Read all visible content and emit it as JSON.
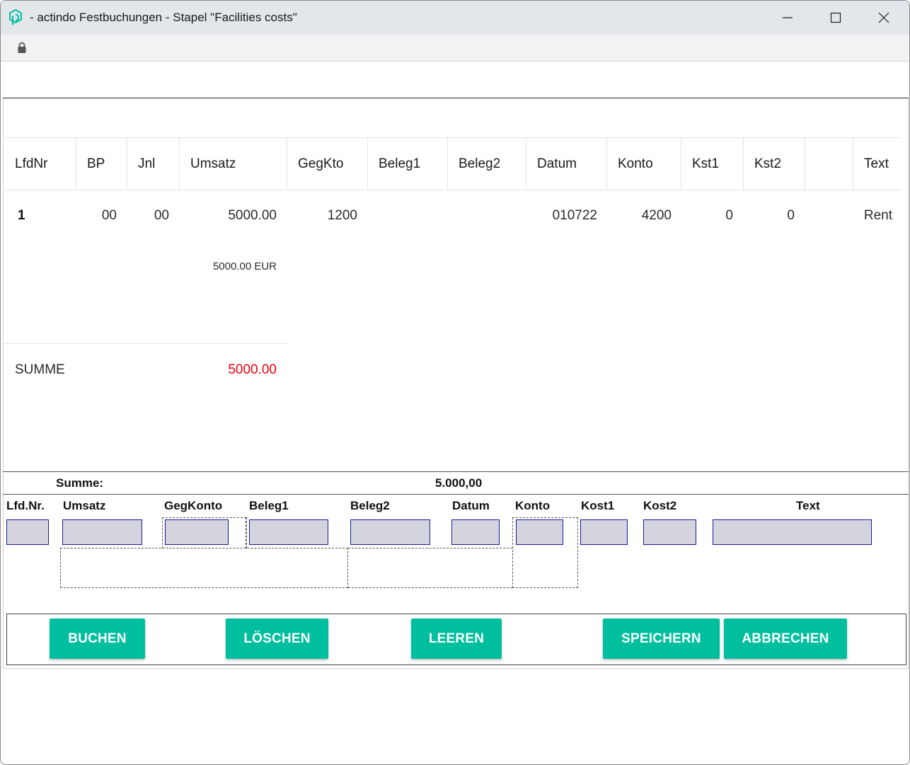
{
  "window": {
    "title": "- actindo Festbuchungen - Stapel \"Facilities costs\"",
    "brand_color": "#00bf9f"
  },
  "grid": {
    "columns": [
      "LfdNr",
      "BP",
      "Jnl",
      "Umsatz",
      "GegKto",
      "Beleg1",
      "Beleg2",
      "Datum",
      "Konto",
      "Kst1",
      "Kst2",
      "",
      "Text"
    ],
    "rows": [
      {
        "LfdNr": "1",
        "BP": "00",
        "Jnl": "00",
        "Umsatz": "5000.00",
        "GegKto": "1200",
        "Beleg1": "",
        "Beleg2": "",
        "Datum": "010722",
        "Konto": "4200",
        "Kst1": "0",
        "Kst2": "0",
        "Text": "Rent"
      }
    ],
    "currency_total": "5000.00 EUR",
    "summe_label": "SUMME",
    "summe_value": "5000.00"
  },
  "summary": {
    "label": "Summe:",
    "value": "5.000,00"
  },
  "form": {
    "labels": {
      "lfdnr": "Lfd.Nr.",
      "umsatz": "Umsatz",
      "gegkonto": "GegKonto",
      "beleg1": "Beleg1",
      "beleg2": "Beleg2",
      "datum": "Datum",
      "konto": "Konto",
      "kost1": "Kost1",
      "kost2": "Kost2",
      "text": "Text"
    },
    "values": {
      "lfdnr": "",
      "umsatz": "",
      "gegkonto": "",
      "beleg1": "",
      "beleg2": "",
      "datum": "",
      "konto": "",
      "kost1": "",
      "kost2": "",
      "text": ""
    }
  },
  "buttons": {
    "buchen": "BUCHEN",
    "loeschen": "LÖSCHEN",
    "leeren": "LEEREN",
    "speichern": "SPEICHERN",
    "abbrechen": "ABBRECHEN"
  }
}
